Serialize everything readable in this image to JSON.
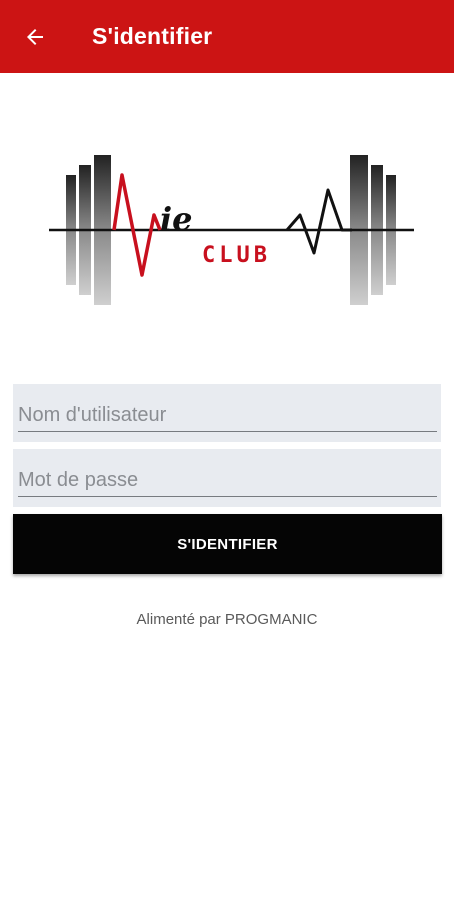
{
  "appbar": {
    "title": "S'identifier",
    "back_icon": "arrow-left-icon",
    "color": "#cc1414"
  },
  "logo": {
    "text_main": "ie",
    "text_sub": "CLUB",
    "accent_color": "#c8101e"
  },
  "form": {
    "username_placeholder": "Nom d'utilisateur",
    "username_value": "",
    "password_placeholder": "Mot de passe",
    "password_value": "",
    "submit_label": "S'IDENTIFIER",
    "field_bg": "#e8ebf0",
    "button_bg": "#050505"
  },
  "footer": {
    "powered_by": "Alimenté par PROGMANIC"
  }
}
